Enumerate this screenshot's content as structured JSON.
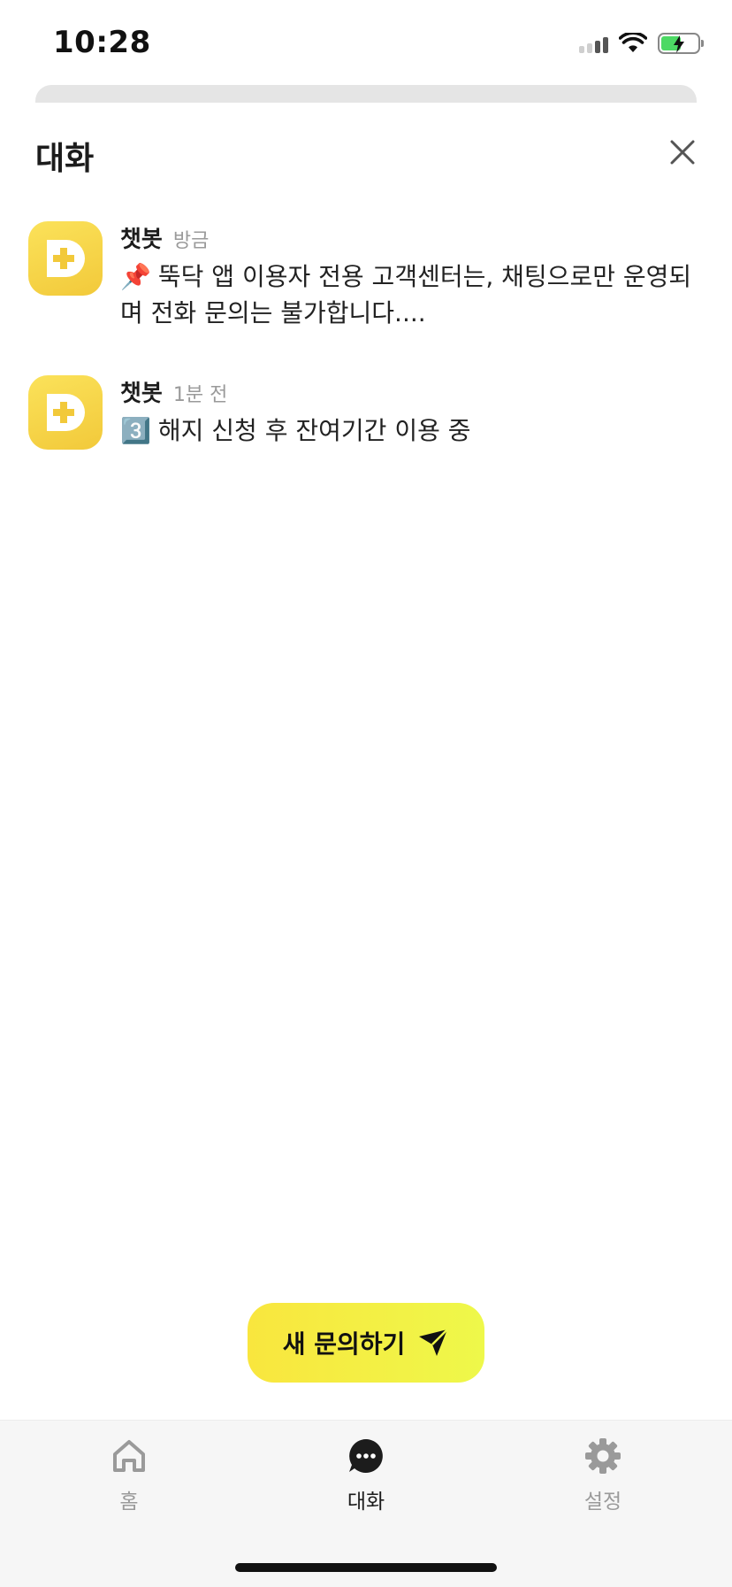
{
  "status_bar": {
    "time": "10:28"
  },
  "header": {
    "title": "대화"
  },
  "conversations": [
    {
      "sender": "챗봇",
      "time": "방금",
      "emoji": "📌",
      "message": "뚝닥 앱 이용자 전용 고객센터는, 채팅으로만 운영되며 전화 문의는 불가합니다...."
    },
    {
      "sender": "챗봇",
      "time": "1분 전",
      "emoji": "3️⃣",
      "message": "해지 신청 후 잔여기간 이용 중"
    }
  ],
  "new_inquiry": {
    "label": "새 문의하기"
  },
  "tabs": [
    {
      "label": "홈",
      "icon": "home-icon",
      "active": false
    },
    {
      "label": "대화",
      "icon": "chat-bubble-icon",
      "active": true
    },
    {
      "label": "설정",
      "icon": "gear-icon",
      "active": false
    }
  ],
  "colors": {
    "accent_yellow": "#f9e63e",
    "avatar_yellow": "#f5d23f",
    "tab_bar_bg": "#f6f6f6",
    "muted_text": "#9a9a9a",
    "battery_green": "#4cd964"
  },
  "battery_level": 0.55
}
